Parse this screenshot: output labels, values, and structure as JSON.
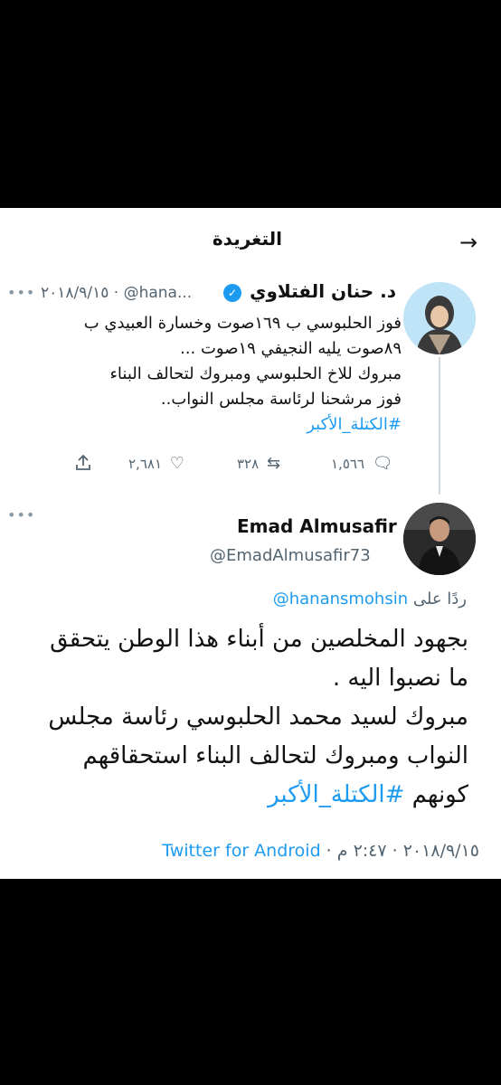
{
  "header": {
    "title": "التغريدة",
    "back_icon": "arrow-right-icon"
  },
  "tweet1": {
    "name": "د. حنان الفتلاوي",
    "verified_icon": "verified-badge-icon",
    "meta": "٢٠١٨/٩/١٥ · @hana...",
    "lines": [
      "فوز الحلبوسي ب ١٦٩صوت وخسارة العبيدي ب",
      "٨٩صوت يليه النجيفي ١٩صوت ...",
      "مبروك للاخ الحلبوسي ومبروك لتحالف البناء",
      "فوز مرشحنا لرئاسة مجلس النواب.."
    ],
    "hashtag": "#الكتلة_الأكبر",
    "actions": {
      "replies": "١,٥٦٦",
      "retweets": "٣٢٨",
      "likes": "٢,٦٨١"
    }
  },
  "tweet2": {
    "name": "Emad Almusafir",
    "handle": "@EmadAlmusafir73",
    "reply_prefix": "ردًا على",
    "reply_handle": "@hanansmohsin",
    "lines": [
      "بجهود المخلصين من أبناء هذا الوطن يتحقق",
      "ما نصبوا اليه .",
      "مبروك لسيد محمد الحلبوسي رئاسة مجلس",
      "النواب ومبروك لتحالف البناء استحقاقهم"
    ],
    "last_line_text": "كونهم",
    "hashtag": "#الكتلة_الأكبر",
    "date": "٢٠١٨/٩/١٥",
    "time": "٢:٤٧ م",
    "source": "Twitter for Android",
    "separator": "·"
  },
  "more_icon": "more-options-icon"
}
